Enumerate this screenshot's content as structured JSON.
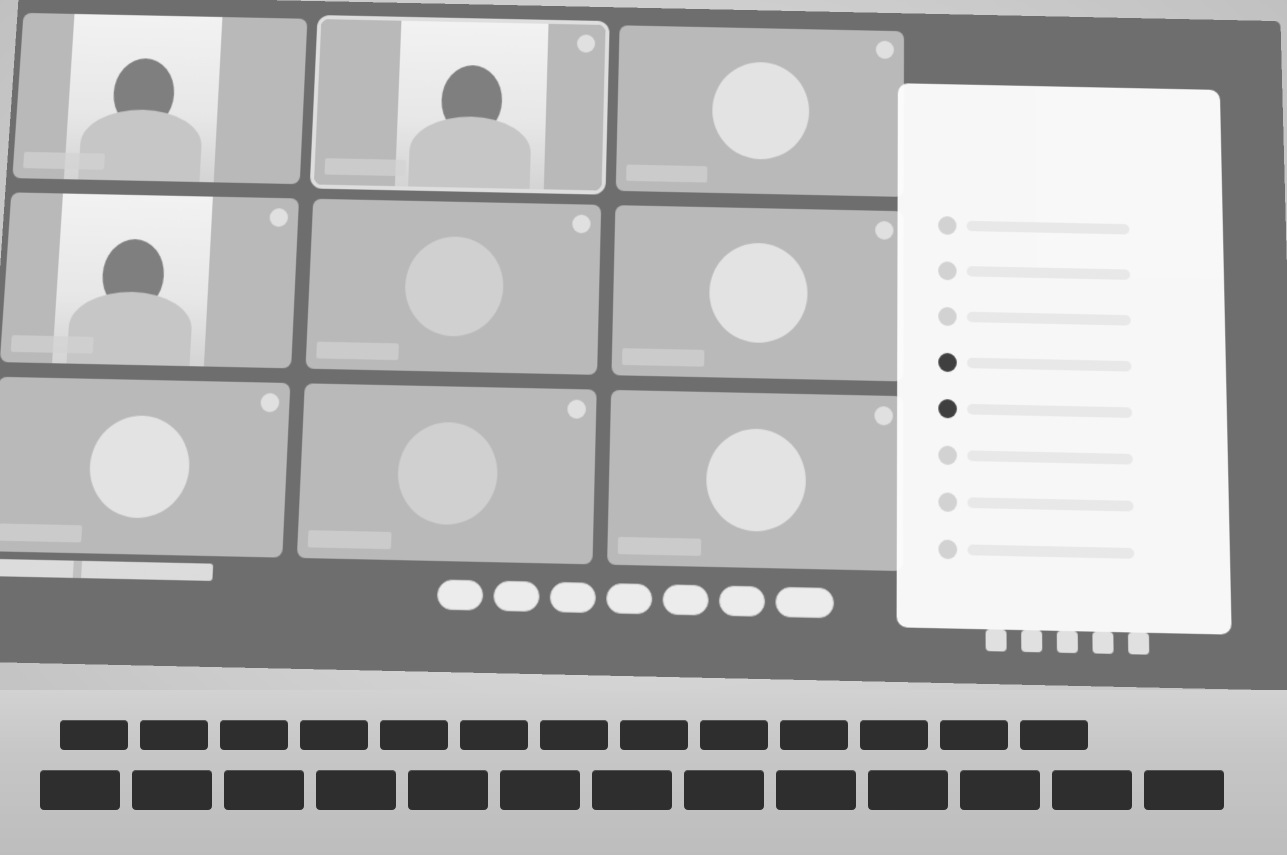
{
  "panel": {
    "rows": [
      {
        "avatar": "gray"
      },
      {
        "avatar": "gray"
      },
      {
        "avatar": "gray"
      },
      {
        "avatar": "dark"
      },
      {
        "avatar": "dark"
      },
      {
        "avatar": "gray"
      },
      {
        "avatar": "gray"
      },
      {
        "avatar": "gray"
      }
    ]
  },
  "meeting": {
    "tiles": [
      {
        "type": "video",
        "selected": false,
        "video_align": "left",
        "has_pin": false
      },
      {
        "type": "video",
        "selected": true,
        "video_align": "center",
        "has_pin": true
      },
      {
        "type": "avatar",
        "selected": false,
        "avatar": "light",
        "has_pin": true
      },
      {
        "type": "video",
        "selected": false,
        "video_align": "left",
        "has_pin": true
      },
      {
        "type": "avatar",
        "selected": false,
        "avatar": "dim",
        "has_pin": true
      },
      {
        "type": "avatar",
        "selected": false,
        "avatar": "light",
        "has_pin": true
      },
      {
        "type": "avatar",
        "selected": false,
        "avatar": "light",
        "has_pin": true
      },
      {
        "type": "avatar",
        "selected": false,
        "avatar": "dim",
        "has_pin": true
      },
      {
        "type": "avatar",
        "selected": false,
        "avatar": "light",
        "has_pin": true
      }
    ],
    "controls": [
      "mic",
      "camera",
      "captions",
      "raise-hand",
      "present",
      "more",
      "leave"
    ],
    "right_icons": [
      "info",
      "people",
      "chat",
      "activities",
      "lock"
    ]
  },
  "colors": {
    "screen": "#6e6e6e",
    "panel": "#ffffff",
    "keycap": "#2e2e2e"
  }
}
